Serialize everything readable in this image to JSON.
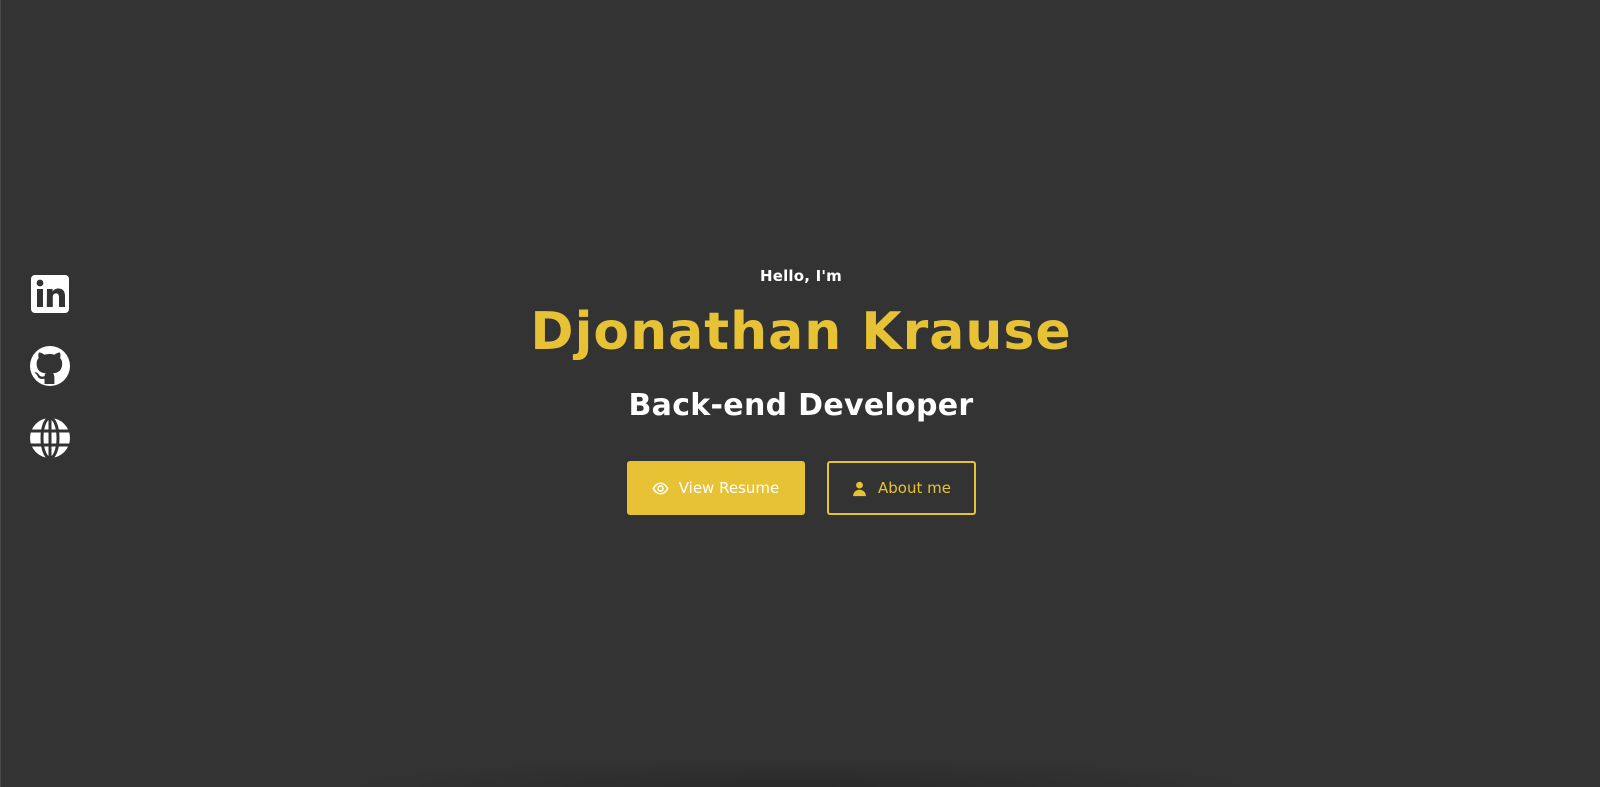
{
  "social": {
    "items": [
      {
        "icon": "linkedin-icon"
      },
      {
        "icon": "github-icon"
      },
      {
        "icon": "globe-icon"
      }
    ]
  },
  "hero": {
    "greeting": "Hello, I'm",
    "name": "Djonathan Krause",
    "role": "Back-end Developer",
    "primary_button": {
      "label": "View Resume",
      "icon": "eye-icon"
    },
    "secondary_button": {
      "label": "About me",
      "icon": "user-icon"
    }
  },
  "colors": {
    "background": "#333333",
    "accent": "#e7c235",
    "text": "#ffffff"
  }
}
